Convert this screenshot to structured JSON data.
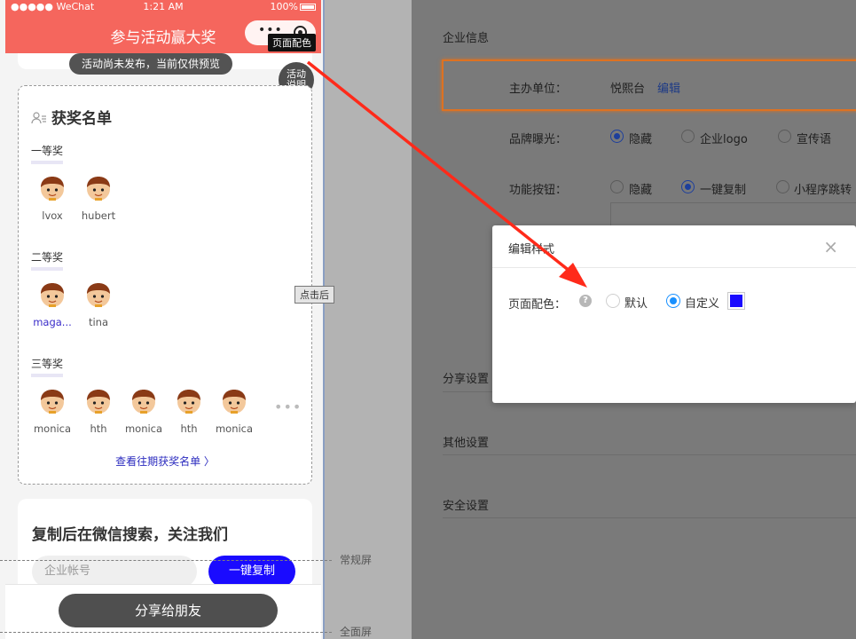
{
  "phone": {
    "status": {
      "carrier": "●●●●● WeChat",
      "time": "1:21 AM",
      "battery": "100%"
    },
    "nav_title": "参与活动赢大奖",
    "capsule_dots": "•••",
    "tooltip_page_color": "页面配色",
    "notice_pill": "活动尚未发布，当前仅供预览",
    "activity_fab": "活动说明",
    "winners": {
      "title": "获奖名单",
      "prizes": [
        {
          "label": "一等奖",
          "names": [
            "lvox",
            "hubert"
          ]
        },
        {
          "label": "二等奖",
          "names": [
            "maga...",
            "tina"
          ]
        },
        {
          "label": "三等奖",
          "names": [
            "monica",
            "hth",
            "monica",
            "hth",
            "monica"
          ]
        }
      ],
      "more": "•••",
      "view_history": "查看往期获奖名单 〉"
    },
    "follow": {
      "title": "复制后在微信搜索，关注我们",
      "input_placeholder": "企业帐号",
      "copy_button": "一键复制"
    },
    "share_button": "分享给朋友",
    "click_tooltip": "点击后",
    "screen_labels": {
      "normal": "常规屏",
      "full": "全面屏"
    }
  },
  "settings": {
    "enterprise_info": "企业信息",
    "host_label": "主办单位：",
    "host_value": "悦熙台",
    "host_edit": "编辑",
    "brand_label": "品牌曝光：",
    "brand_options": [
      "隐藏",
      "企业logo",
      "宣传语"
    ],
    "brand_selected": 0,
    "func_label": "功能按钮：",
    "func_options": [
      "隐藏",
      "一键复制",
      "小程序跳转"
    ],
    "func_selected": 1,
    "share_settings": "分享设置",
    "other_settings": "其他设置",
    "security_settings": "安全设置"
  },
  "modal": {
    "title": "编辑样式",
    "close": "×",
    "label": "页面配色：",
    "help": "?",
    "options": [
      "默认",
      "自定义"
    ],
    "selected": 1,
    "custom_color": "#1a0bff"
  },
  "colors": {
    "header": "#f5665d",
    "copy_button": "#1a0bff",
    "overlay": "#7a7a7a",
    "arrow": "#ff2a1a",
    "highlight": "#dd7222"
  }
}
